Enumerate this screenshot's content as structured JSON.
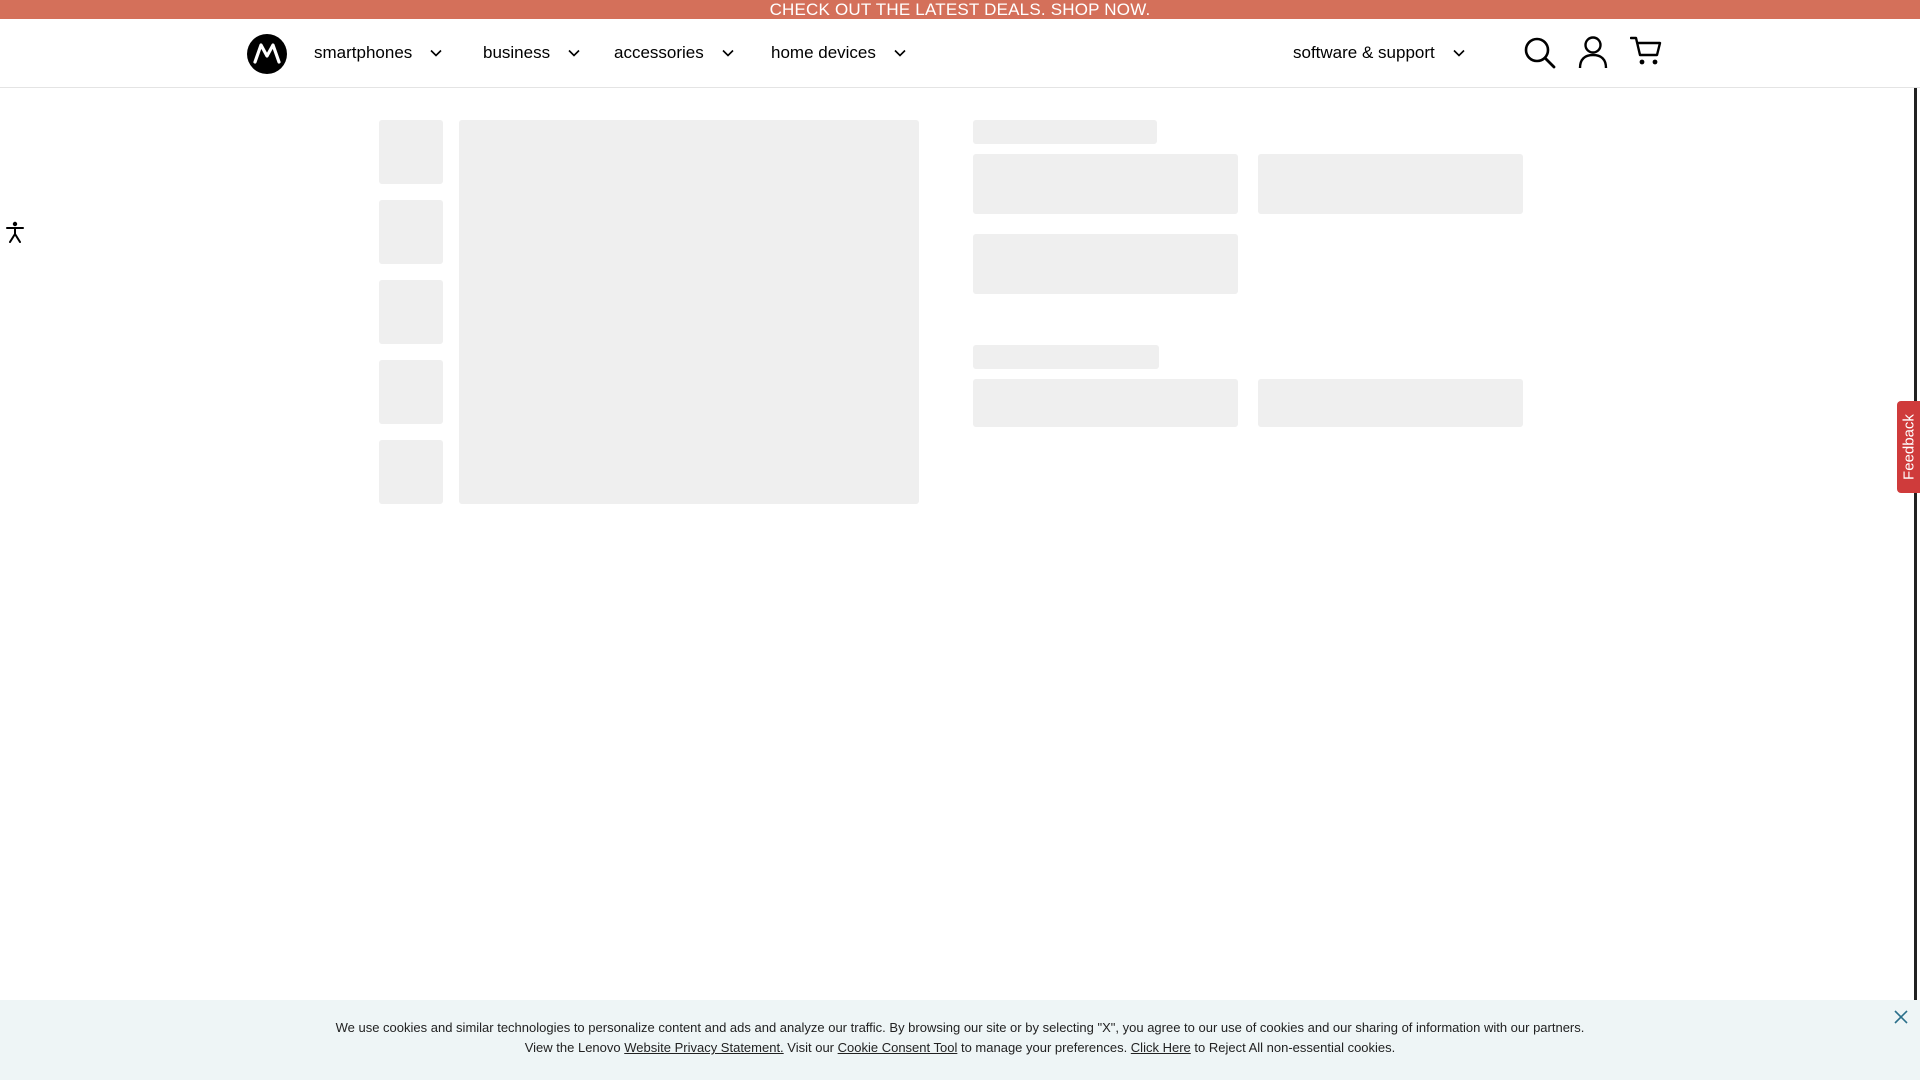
{
  "promo": {
    "text": "CHECK OUT THE LATEST DEALS. SHOP NOW."
  },
  "header": {
    "logo_icon": "motorola-logo-icon",
    "nav": [
      {
        "label": "smartphones"
      },
      {
        "label": "business"
      },
      {
        "label": "accessories"
      },
      {
        "label": "home devices"
      },
      {
        "label": "software & support"
      }
    ],
    "icons": [
      "search-icon",
      "account-icon",
      "cart-icon"
    ]
  },
  "accessibility": {
    "icon": "accessibility-icon"
  },
  "feedback": {
    "label": "Feedback"
  },
  "cookie": {
    "line1": "We use cookies and similar technologies to personalize content and ads and analyze our traffic. By browsing our site or by selecting \"X\", you agree to our use of cookies and our sharing of information with our partners.",
    "line2_prefix": "View the Lenovo ",
    "privacy_link": "Website Privacy Statement.",
    "line2_mid": " Visit our ",
    "consent_link": "Cookie Consent Tool",
    "line2_mid2": " to manage your preferences. ",
    "click_here_link": "Click Here",
    "line2_suffix": " to Reject All non-essential cookies.",
    "close_icon": "close-icon"
  },
  "colors": {
    "promo_bg": "#d4705a",
    "skeleton": "#efefef",
    "feedback_bg": "#cf3b3b",
    "cookie_bg": "#eef5f6"
  }
}
